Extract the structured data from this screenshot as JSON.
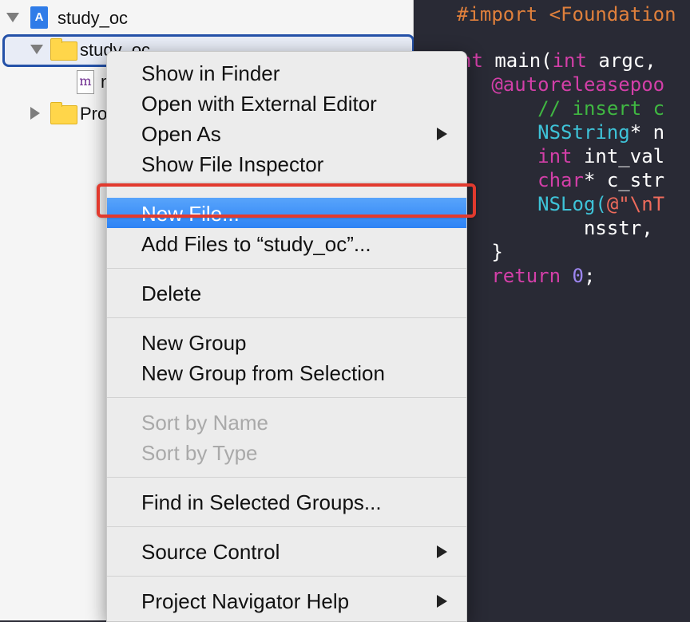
{
  "navigator": {
    "project_name": "study_oc",
    "group_name": "study_oc",
    "file_partial": "m",
    "products_partial": "Pro"
  },
  "editor": {
    "lines": [
      {
        "parts": [
          {
            "t": "#import <Foundation",
            "c": "k-import"
          }
        ]
      },
      {
        "parts": []
      },
      {
        "parts": [
          {
            "t": "nt ",
            "c": "k-pink"
          },
          {
            "t": "main(",
            "c": "k-white"
          },
          {
            "t": "int",
            "c": "k-pink"
          },
          {
            "t": " argc,",
            "c": "k-white"
          }
        ]
      },
      {
        "parts": [
          {
            "t": "   @autoreleasepoo",
            "c": "k-pink"
          }
        ]
      },
      {
        "parts": [
          {
            "t": "       // insert c",
            "c": "k-green"
          }
        ]
      },
      {
        "parts": [
          {
            "t": "       NSString",
            "c": "k-cyan"
          },
          {
            "t": "* n",
            "c": "k-white"
          }
        ]
      },
      {
        "parts": [
          {
            "t": "       int",
            "c": "k-pink"
          },
          {
            "t": " int_val",
            "c": "k-white"
          }
        ]
      },
      {
        "parts": [
          {
            "t": "       char",
            "c": "k-pink"
          },
          {
            "t": "* c_str",
            "c": "k-white"
          }
        ]
      },
      {
        "parts": [
          {
            "t": "       NSLog(",
            "c": "k-cyan"
          },
          {
            "t": "@\"\\nT",
            "c": "k-red"
          }
        ]
      },
      {
        "parts": [
          {
            "t": "           nsstr,",
            "c": "k-white"
          }
        ]
      },
      {
        "parts": [
          {
            "t": "   }",
            "c": "k-white"
          }
        ]
      },
      {
        "parts": [
          {
            "t": "   return",
            "c": "k-pink"
          },
          {
            "t": " ",
            "c": "k-white"
          },
          {
            "t": "0",
            "c": "k-num"
          },
          {
            "t": ";",
            "c": "k-white"
          }
        ]
      }
    ]
  },
  "context_menu": {
    "items": [
      {
        "label": "Show in Finder"
      },
      {
        "label": "Open with External Editor"
      },
      {
        "label": "Open As"
      },
      {
        "label": "Show File Inspector"
      },
      {
        "label": "New File..."
      },
      {
        "label": "Add Files to “study_oc”..."
      },
      {
        "label": "Delete"
      },
      {
        "label": "New Group"
      },
      {
        "label": "New Group from Selection"
      },
      {
        "label": "Sort by Name"
      },
      {
        "label": "Sort by Type"
      },
      {
        "label": "Find in Selected Groups..."
      },
      {
        "label": "Source Control"
      },
      {
        "label": "Project Navigator Help"
      }
    ],
    "highlighted_item": "New File..."
  },
  "colors": {
    "highlight": "#2d83f5",
    "annotation_box": "#e23a2e",
    "editor_bg": "#292a35"
  }
}
